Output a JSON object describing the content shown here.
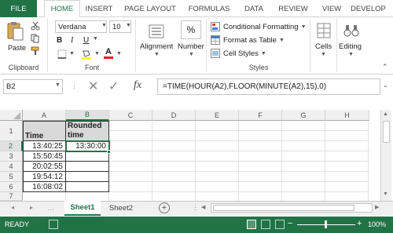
{
  "tabs": [
    "FILE",
    "HOME",
    "INSERT",
    "PAGE LAYOUT",
    "FORMULAS",
    "DATA",
    "REVIEW",
    "VIEW",
    "DEVELOP"
  ],
  "clipboard": {
    "paste": "Paste",
    "label": "Clipboard"
  },
  "font": {
    "name": "Verdana",
    "size": "10",
    "label": "Font",
    "bold": "B",
    "italic": "I",
    "underline": "U",
    "grow": "A",
    "shrink": "A",
    "color_letter": "A"
  },
  "alignment": {
    "label": "Alignment"
  },
  "number": {
    "label": "Number",
    "symbol": "%"
  },
  "styles": {
    "conditional": "Conditional Formatting",
    "table": "Format as Table",
    "cell": "Cell Styles",
    "label": "Styles"
  },
  "cells": {
    "label": "Cells"
  },
  "editing": {
    "label": "Editing"
  },
  "formula_bar": {
    "name_box": "B2",
    "fx": "fx",
    "formula": "=TIME(HOUR(A2),FLOOR(MINUTE(A2),15),0)"
  },
  "columns": [
    "A",
    "B",
    "C",
    "D",
    "E",
    "F",
    "G",
    "H"
  ],
  "rows": [
    "1",
    "2",
    "3",
    "4",
    "5",
    "6",
    "7"
  ],
  "table": {
    "header_a": "Time",
    "header_b_line1": "Rounded",
    "header_b_line2": "time",
    "a_values": [
      "13:40:25",
      "15:50:45",
      "20:02:55",
      "19:54:12",
      "16:08:02"
    ],
    "b_values": [
      "13:30:00",
      "",
      "",
      "",
      ""
    ]
  },
  "sheets": [
    "Sheet1",
    "Sheet2"
  ],
  "status": {
    "ready": "READY",
    "zoom": "100%"
  },
  "colors": {
    "accent": "#217346"
  }
}
